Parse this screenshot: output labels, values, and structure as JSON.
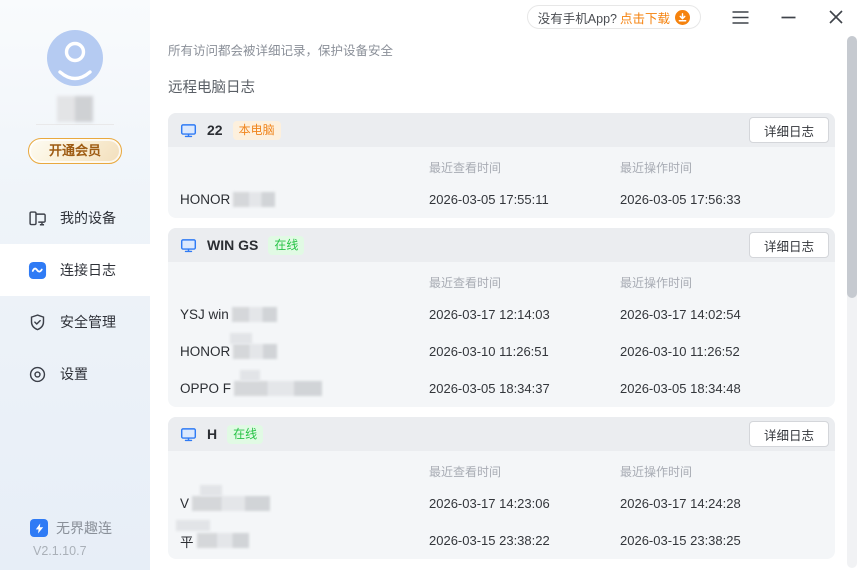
{
  "titlebar": {
    "download_prompt": "没有手机App?",
    "download_action": "点击下载"
  },
  "sidebar": {
    "vip_button": "开通会员",
    "menu": [
      {
        "label": "我的设备"
      },
      {
        "label": "连接日志"
      },
      {
        "label": "安全管理"
      },
      {
        "label": "设置"
      }
    ],
    "brand": {
      "name": "无界趣连",
      "version": "V2.1.10.7"
    }
  },
  "main": {
    "note": "所有访问都会被详细记录，保护设备安全",
    "section_title": "远程电脑日志",
    "columns": {
      "viewed": "最近查看时间",
      "operated": "最近操作时间"
    },
    "detail_button": "详细日志",
    "devices": [
      {
        "name": "22",
        "badge": "本电脑",
        "rows": [
          {
            "visitor": "HONOR",
            "viewed": "2026-03-05 17:55:11",
            "operated": "2026-03-05 17:56:33"
          }
        ]
      },
      {
        "name": "WIN GS",
        "badge": "在线",
        "rows": [
          {
            "visitor": "YSJ win",
            "viewed": "2026-03-17 12:14:03",
            "operated": "2026-03-17 14:02:54"
          },
          {
            "visitor": "HONOR",
            "viewed": "2026-03-10 11:26:51",
            "operated": "2026-03-10 11:26:52"
          },
          {
            "visitor": "OPPO F",
            "viewed": "2026-03-05 18:34:37",
            "operated": "2026-03-05 18:34:48"
          }
        ]
      },
      {
        "name": "H",
        "badge": "在线",
        "rows": [
          {
            "visitor": "V",
            "viewed": "2026-03-17 14:23:06",
            "operated": "2026-03-17 14:24:28"
          },
          {
            "visitor": "平",
            "viewed": "2026-03-15 23:38:22",
            "operated": "2026-03-15 23:38:25"
          }
        ]
      }
    ]
  },
  "colors": {
    "accent_blue": "#2f7bf5",
    "accent_orange": "#f5820d",
    "online_green": "#27c346",
    "card_header": "#ebedf0",
    "card_body": "#f4f6f8"
  }
}
